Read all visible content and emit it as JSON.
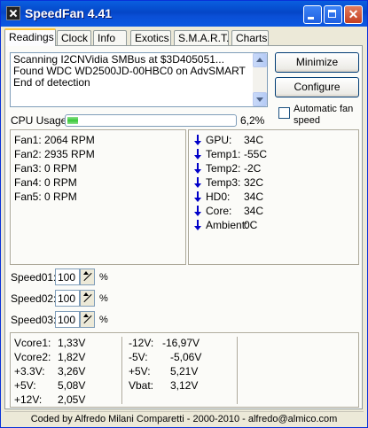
{
  "window": {
    "title": "SpeedFan 4.41",
    "close_glyph": "✕"
  },
  "tabs": [
    "Readings",
    "Clock",
    "Info",
    "Exotics",
    "S.M.A.R.T.",
    "Charts"
  ],
  "log": {
    "lines": [
      "Scanning I2CNVidia SMBus at $3D405051...",
      "Found WDC WD2500JD-00HBC0 on AdvSMART",
      "End of detection"
    ]
  },
  "buttons": {
    "minimize": "Minimize",
    "configure": "Configure"
  },
  "auto_fan": {
    "label": "Automatic fan speed",
    "checked": false
  },
  "cpu": {
    "label": "CPU Usage",
    "value": "6,2%",
    "fraction": 0.062
  },
  "fans": [
    {
      "label": "Fan1:",
      "value": "2064 RPM"
    },
    {
      "label": "Fan2:",
      "value": "2935 RPM"
    },
    {
      "label": "Fan3:",
      "value": "0 RPM"
    },
    {
      "label": "Fan4:",
      "value": "0 RPM"
    },
    {
      "label": "Fan5:",
      "value": "0 RPM"
    }
  ],
  "temps": [
    {
      "label": "GPU:",
      "value": "34C"
    },
    {
      "label": "Temp1:",
      "value": "-55C"
    },
    {
      "label": "Temp2:",
      "value": "-2C"
    },
    {
      "label": "Temp3:",
      "value": "32C"
    },
    {
      "label": "HD0:",
      "value": "34C"
    },
    {
      "label": "Core:",
      "value": "34C"
    },
    {
      "label": "Ambient:",
      "value": "0C"
    }
  ],
  "speeds": [
    {
      "label": "Speed01:",
      "value": "100",
      "unit": "%"
    },
    {
      "label": "Speed02:",
      "value": "100",
      "unit": "%"
    },
    {
      "label": "Speed03:",
      "value": "100",
      "unit": "%"
    }
  ],
  "voltages_left": [
    {
      "label": "Vcore1:",
      "value": "1,33V"
    },
    {
      "label": "Vcore2:",
      "value": "1,82V"
    },
    {
      "label": "+3.3V:",
      "value": "3,26V"
    },
    {
      "label": "+5V:",
      "value": "5,08V"
    },
    {
      "label": "+12V:",
      "value": "2,05V"
    }
  ],
  "voltages_right": [
    {
      "label": "-12V:",
      "value": "-16,97V"
    },
    {
      "label": "-5V:",
      "value": "-5,06V"
    },
    {
      "label": "+5V:",
      "value": "5,21V"
    },
    {
      "label": "Vbat:",
      "value": "3,12V"
    }
  ],
  "footer": "Coded by Alfredo Milani Comparetti - 2000-2010 - alfredo@almico.com",
  "colors": {
    "accent": "#0a5fe0",
    "progress": "#37c837",
    "arrow": "#0000c8"
  }
}
